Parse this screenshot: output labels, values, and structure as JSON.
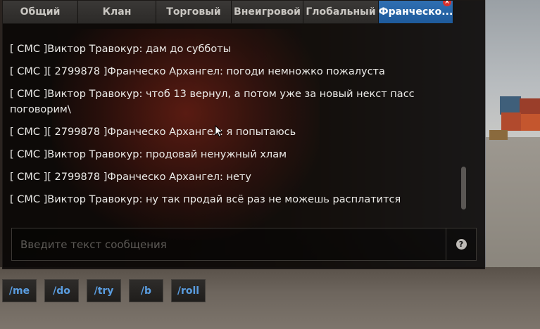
{
  "tabs": [
    {
      "label": "Общий"
    },
    {
      "label": "Клан"
    },
    {
      "label": "Торговый"
    },
    {
      "label": "Внеигровой"
    },
    {
      "label": "Глобальный"
    },
    {
      "label": "Франческо...",
      "active": true,
      "close": "×"
    }
  ],
  "messages": [
    "[ СМС ]Виктор Травокур: дам до субботы",
    "[ СМС ][ 2799878 ]Франческо Архангел: погоди немножко пожалуста",
    "[ СМС ]Виктор Травокур: чтоб 13 вернул, а потом уже за новый некст пасс поговорим\\",
    "[ СМС ][ 2799878 ]Франческо Архангел: я попытаюсь",
    "[ СМС ]Виктор Травокур: продовай ненужный хлам",
    "[ СМС ][ 2799878 ]Франческо Архангел: нету",
    "[ СМС ]Виктор Травокур: ну так продай всё раз не можешь расплатится"
  ],
  "input": {
    "placeholder": "Введите текст сообщения",
    "value": ""
  },
  "help": "?",
  "commands": [
    "/me",
    "/do",
    "/try",
    "/b",
    "/roll"
  ],
  "colors": {
    "active_tab": "#2467a8",
    "command_text": "#5a9de0",
    "close_badge": "#d8302c"
  }
}
